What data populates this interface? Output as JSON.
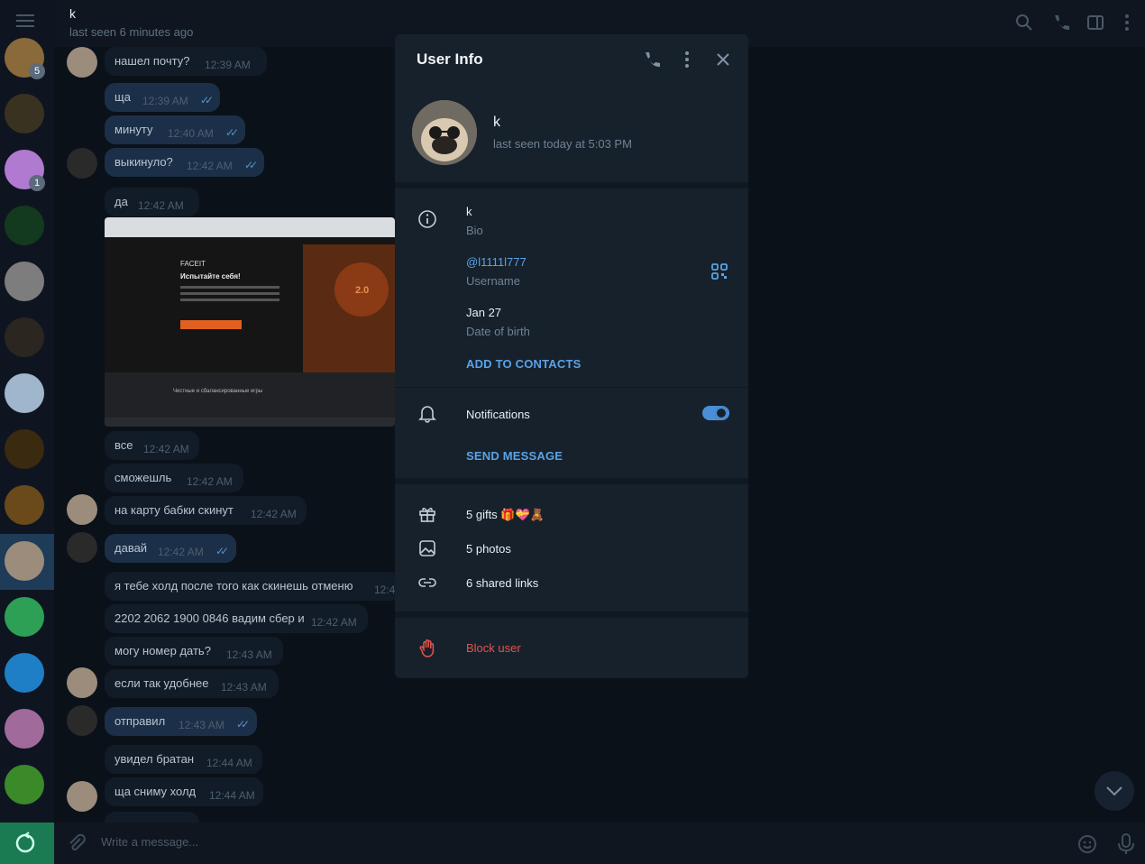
{
  "header": {
    "chat_name": "k",
    "chat_status": "last seen 6 minutes ago",
    "icons": [
      "search-icon",
      "phone-icon",
      "sidebar-icon",
      "more-vertical-icon"
    ]
  },
  "rail": {
    "badges": [
      "5",
      "1"
    ]
  },
  "messages": [
    {
      "text": "нашел почту?",
      "time": "12:39 AM",
      "out": false
    },
    {
      "text": "ща",
      "time": "12:39 AM",
      "out": true
    },
    {
      "text": "минуту",
      "time": "12:40 AM",
      "out": true
    },
    {
      "text": "выкинуло?",
      "time": "12:42 AM",
      "out": true
    },
    {
      "text": "да",
      "time": "12:42 AM",
      "out": false
    },
    {
      "text": "все",
      "time": "12:42 AM",
      "out": false
    },
    {
      "text": "сможешль",
      "time": "12:42 AM",
      "out": false
    },
    {
      "text": "на карту бабки скинут",
      "time": "12:42 AM",
      "out": false
    },
    {
      "text": "давай",
      "time": "12:42 AM",
      "out": true
    },
    {
      "text": "я тебе холд после того как скинешь отменю",
      "time": "12:4",
      "out": false
    },
    {
      "text": "2202 2062 1900 0846 вадим сбер и",
      "time": "12:42 AM",
      "out": false
    },
    {
      "text": "могу номер дать?",
      "time": "12:43 AM",
      "out": false
    },
    {
      "text": "если так удобнее",
      "time": "12:43 AM",
      "out": false
    },
    {
      "text": "отправил",
      "time": "12:43 AM",
      "out": true
    },
    {
      "text": "увидел братан",
      "time": "12:44 AM",
      "out": false
    },
    {
      "text": "ща сниму холд",
      "time": "12:44 AM",
      "out": false
    }
  ],
  "screenshot_preview": {
    "brand": "FACEIT",
    "headline": "Испытайте себя!",
    "rating": "2.0",
    "section": "Честные и сбалансированные игры"
  },
  "composer": {
    "placeholder": "Write a message..."
  },
  "user_info": {
    "title": "User Info",
    "name": "k",
    "status": "last seen today at 5:03 PM",
    "bio_value": "k",
    "bio_label": "Bio",
    "username_value": "@l1111l777",
    "username_label": "Username",
    "birth_value": "Jan 27",
    "birth_label": "Date of birth",
    "add_contacts": "ADD TO CONTACTS",
    "notifications_label": "Notifications",
    "notifications_on": true,
    "send_message": "SEND MESSAGE",
    "gifts": "5 gifts 🎁💝🧸",
    "photos": "5 photos",
    "shared_links": "6 shared links",
    "block_user": "Block user"
  },
  "colors": {
    "accent": "#5aa2e8",
    "danger": "#e5534b",
    "panel": "#17212b",
    "outgoing_bubble": "#1b3048"
  }
}
